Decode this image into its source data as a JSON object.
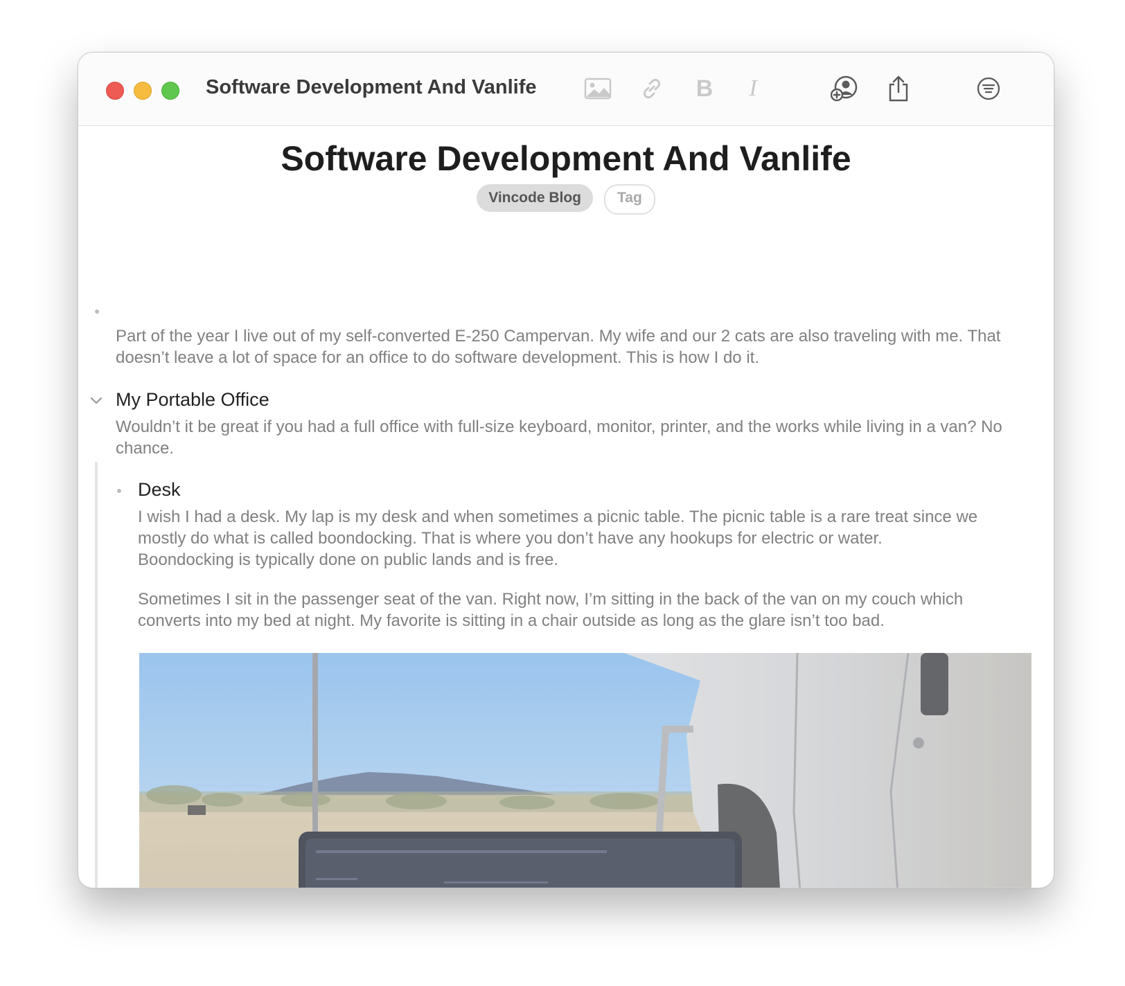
{
  "window": {
    "title": "Software Development And Vanlife"
  },
  "toolbar": {
    "icons": [
      "image-icon",
      "link-icon",
      "bold-icon",
      "italic-icon",
      "collaborate-icon",
      "share-icon",
      "filter-menu-icon"
    ],
    "bold_glyph": "B",
    "italic_glyph": "I"
  },
  "document": {
    "title": "Software Development And Vanlife",
    "tags": [
      "Vincode Blog",
      "Tag"
    ],
    "intro": "Part of the year I live out of my self-converted E-250 Campervan. My wife and our 2 cats are also traveling with me. That doesn’t leave a lot of space for an office to do software development. This is how I do it.",
    "section": {
      "heading": "My Portable Office",
      "body": "Wouldn’t it be great if you had a full office with full-size keyboard, monitor, printer, and the works while living in a van? No chance.",
      "items": [
        {
          "heading": "Desk",
          "paragraphs": [
            "I wish I had a desk. My lap is my desk and when sometimes a picnic table. The picnic table is a rare treat since we mostly do what is called boondocking. That is where you don’t have any hookups for electric or water. Boondocking is typically done on public lands and is free.",
            "Sometimes I sit in the passenger seat of the van. Right now, I’m sitting in the back of the van on my couch which converts into my bed at night. My favorite is sitting in a chair outside as long as the glare isn’t too bad."
          ]
        }
      ]
    }
  },
  "colors": {
    "close": "#ee5b55",
    "minimize": "#f5bc3f",
    "maximize": "#5fc64e",
    "tag_fill": "#dcdcdc",
    "body_text": "#808080"
  }
}
